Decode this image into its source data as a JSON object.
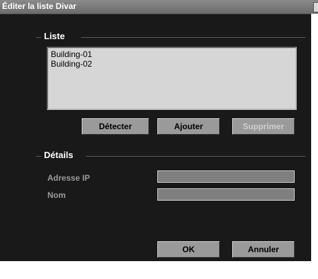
{
  "window": {
    "title": "Éditer la liste Divar"
  },
  "liste": {
    "label": "Liste",
    "items": [
      "Building-01",
      "Building-02"
    ],
    "buttons": {
      "detecter": "Détecter",
      "ajouter": "Ajouter",
      "supprimer": "Supprimer"
    }
  },
  "details": {
    "label": "Détails",
    "ip_label": "Adresse IP",
    "ip_value": "",
    "nom_label": "Nom",
    "nom_value": ""
  },
  "footer": {
    "ok": "OK",
    "annuler": "Annuler"
  }
}
